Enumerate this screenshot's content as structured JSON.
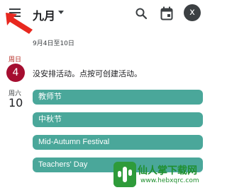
{
  "header": {
    "menu_icon": "hamburger-menu-icon",
    "month_label": "九月",
    "search_icon": "search-icon",
    "today_icon": "calendar-today-icon",
    "avatar_initial": "x"
  },
  "range_label": "9月4日至10日",
  "days": [
    {
      "weekday": "周日",
      "date": "4",
      "today": true,
      "empty_message": "没安排活动。点按可创建活动。"
    },
    {
      "weekday": "周六",
      "date": "10",
      "events": [
        {
          "title": "教师节"
        },
        {
          "title": "中秋节"
        },
        {
          "title": "Mid-Autumn Festival"
        },
        {
          "title": "Teachers' Day"
        }
      ]
    }
  ],
  "colors": {
    "today_circle": "#a50e30",
    "event_chip": "#4aa79a",
    "annotation_arrow": "#e8281f"
  },
  "watermark": {
    "text": "仙人掌下载网",
    "url": "www.hebxqrc.com"
  }
}
